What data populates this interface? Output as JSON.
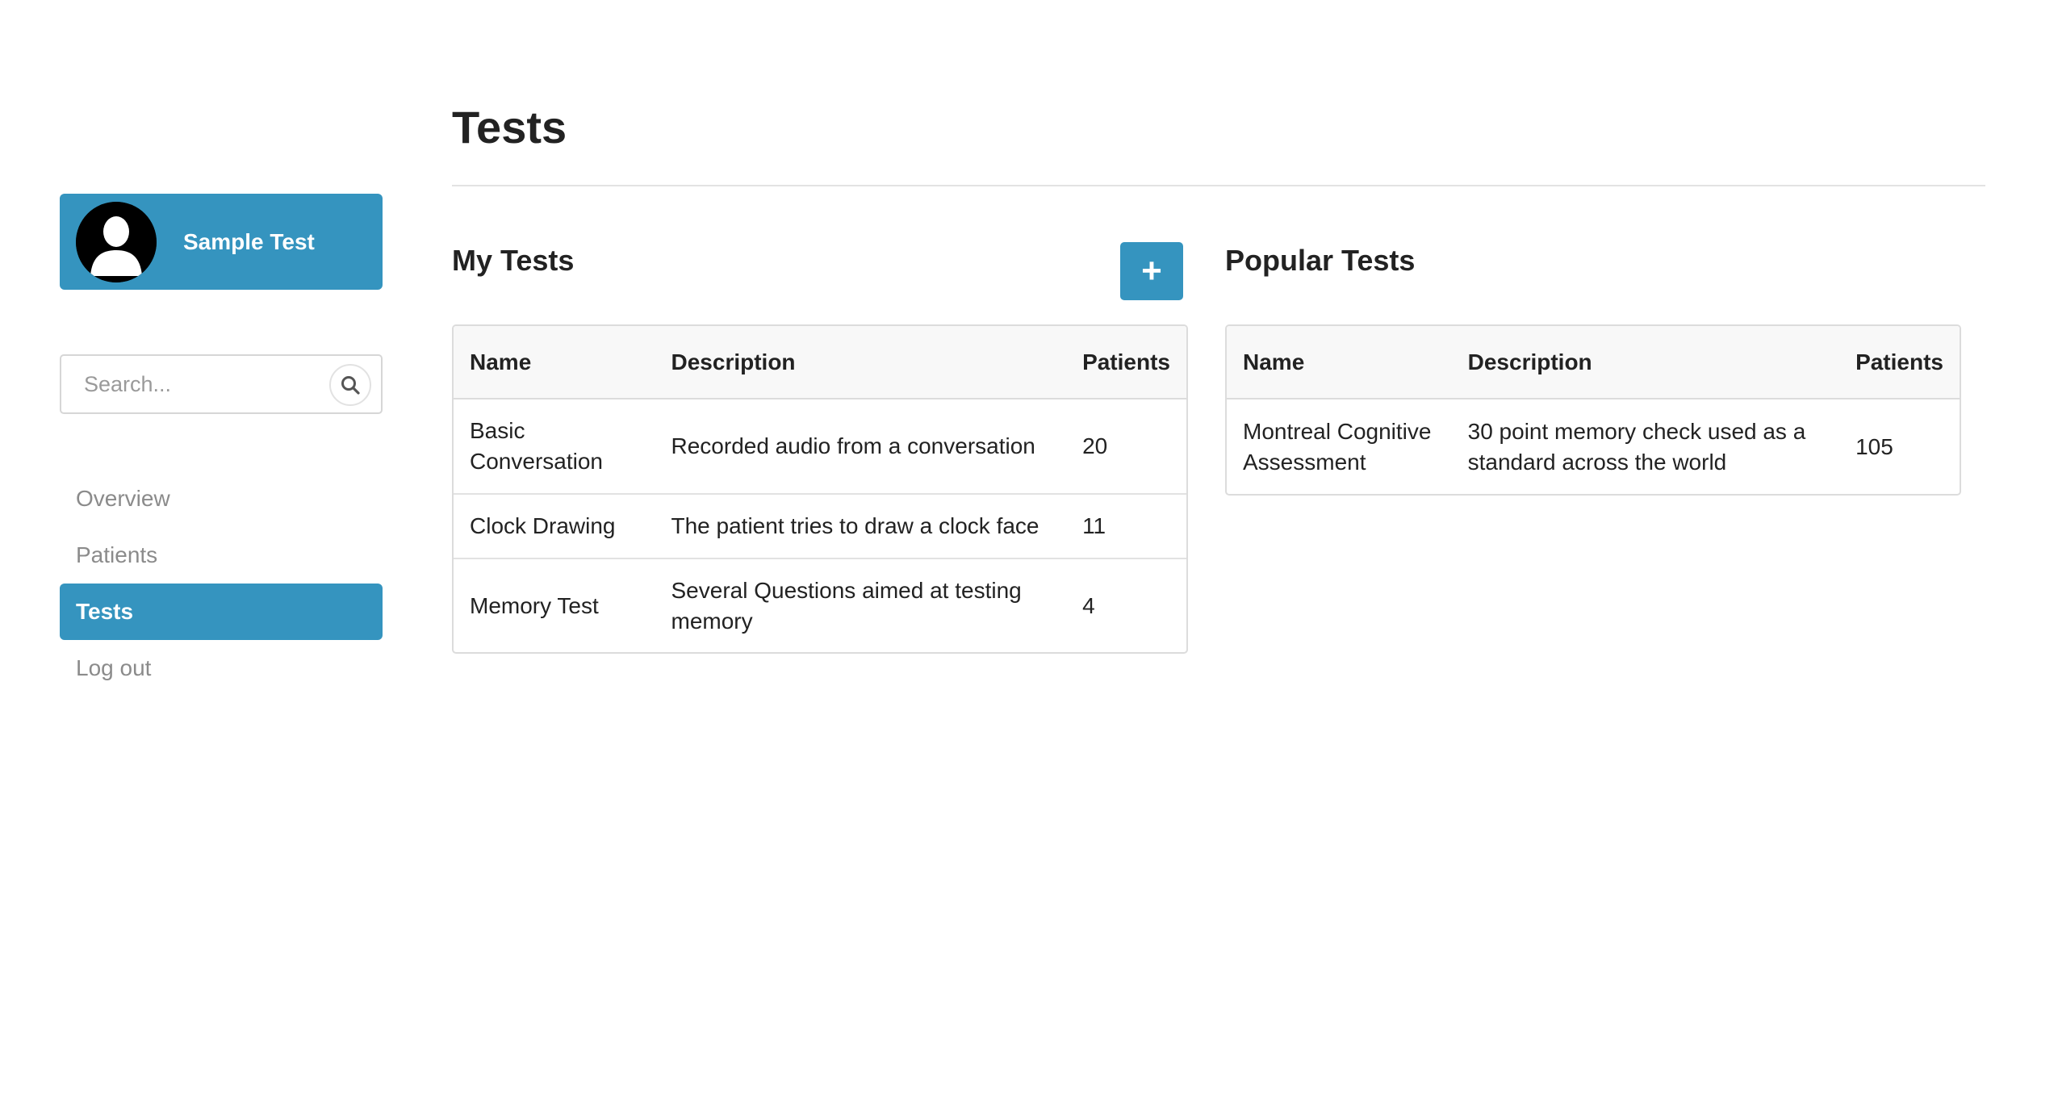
{
  "profile": {
    "name": "Sample Test"
  },
  "search": {
    "placeholder": "Search..."
  },
  "nav": {
    "items": [
      {
        "label": "Overview",
        "active": false
      },
      {
        "label": "Patients",
        "active": false
      },
      {
        "label": "Tests",
        "active": true
      },
      {
        "label": "Log out",
        "active": false
      }
    ]
  },
  "page": {
    "title": "Tests"
  },
  "my_tests": {
    "title": "My Tests",
    "add_label": "+",
    "columns": [
      "Name",
      "Description",
      "Patients"
    ],
    "rows": [
      {
        "name": "Basic Conversation",
        "description": "Recorded audio from a conversation",
        "patients": "20"
      },
      {
        "name": "Clock Drawing",
        "description": "The patient tries to draw a clock face",
        "patients": "11"
      },
      {
        "name": "Memory Test",
        "description": "Several Questions aimed at testing memory",
        "patients": "4"
      }
    ]
  },
  "popular_tests": {
    "title": "Popular Tests",
    "columns": [
      "Name",
      "Description",
      "Patients"
    ],
    "rows": [
      {
        "name": "Montreal Cognitive Assessment",
        "description": "30 point memory check used as a standard across the world",
        "patients": "105"
      }
    ]
  },
  "colors": {
    "accent": "#3594bf",
    "muted_text": "#8b8b8b",
    "border": "#dcdcdc"
  }
}
